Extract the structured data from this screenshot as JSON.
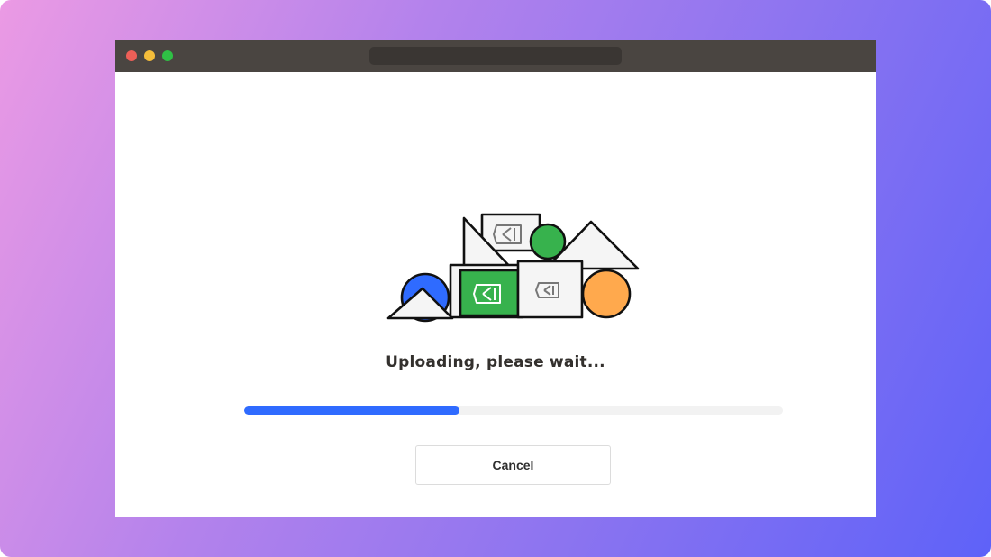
{
  "colors": {
    "background_gradient": [
      "#eb9ae4",
      "#5e62f8"
    ],
    "titlebar": "#4a4541",
    "window_red": "#ed5f57",
    "window_yellow": "#f5bd3a",
    "window_green": "#2fc045",
    "progress_fill": "#2f6bff",
    "progress_track": "#f2f2f2",
    "shape_green": "#37b24d",
    "shape_blue": "#2f6bff",
    "shape_orange": "#ffa94d"
  },
  "illustration": {
    "icon": "stacked-shapes-illustration"
  },
  "upload": {
    "status_text": "Uploading, please wait...",
    "progress_fraction": 0.4
  },
  "actions": {
    "cancel_label": "Cancel"
  }
}
